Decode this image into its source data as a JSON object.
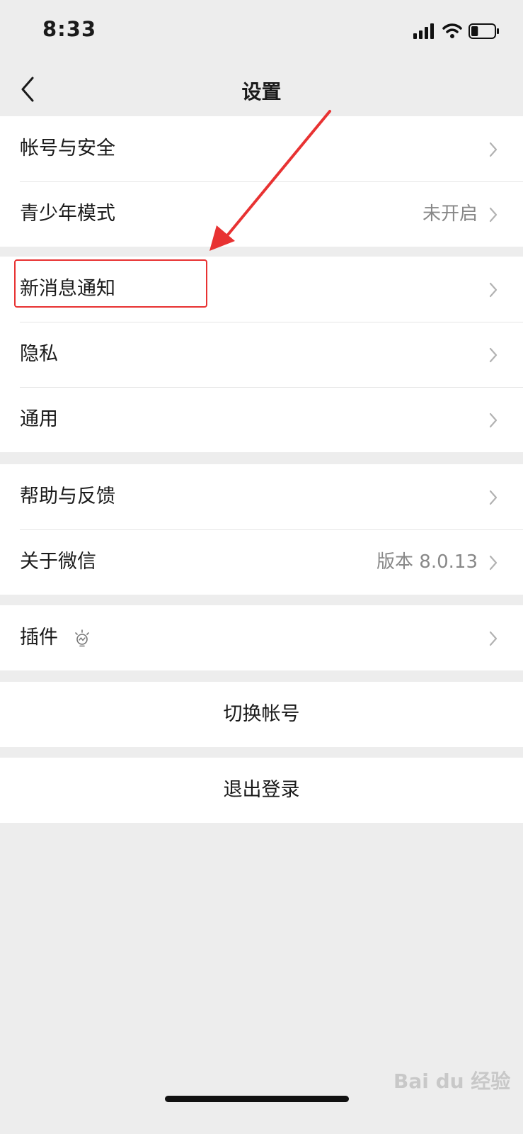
{
  "status_bar": {
    "time": "8:33",
    "signal_icon": "signal-bars-icon",
    "wifi_icon": "wifi-icon",
    "battery_icon": "battery-icon",
    "battery_level": 0.3
  },
  "nav": {
    "back_icon": "chevron-left-icon",
    "title": "设置"
  },
  "groups": [
    {
      "items": [
        {
          "label": "帐号与安全",
          "value": ""
        },
        {
          "label": "青少年模式",
          "value": "未开启"
        }
      ]
    },
    {
      "items": [
        {
          "label": "新消息通知",
          "value": "",
          "highlighted": true
        },
        {
          "label": "隐私",
          "value": ""
        },
        {
          "label": "通用",
          "value": ""
        }
      ]
    },
    {
      "items": [
        {
          "label": "帮助与反馈",
          "value": ""
        },
        {
          "label": "关于微信",
          "value": "版本 8.0.13"
        }
      ]
    },
    {
      "items": [
        {
          "label": "插件",
          "value": "",
          "icon": "plugin-bulb-icon"
        }
      ]
    }
  ],
  "actions": {
    "switch_account": "切换帐号",
    "logout": "退出登录"
  },
  "annotation": {
    "highlight_color": "#e83232"
  },
  "watermark": "Bai du 经验"
}
